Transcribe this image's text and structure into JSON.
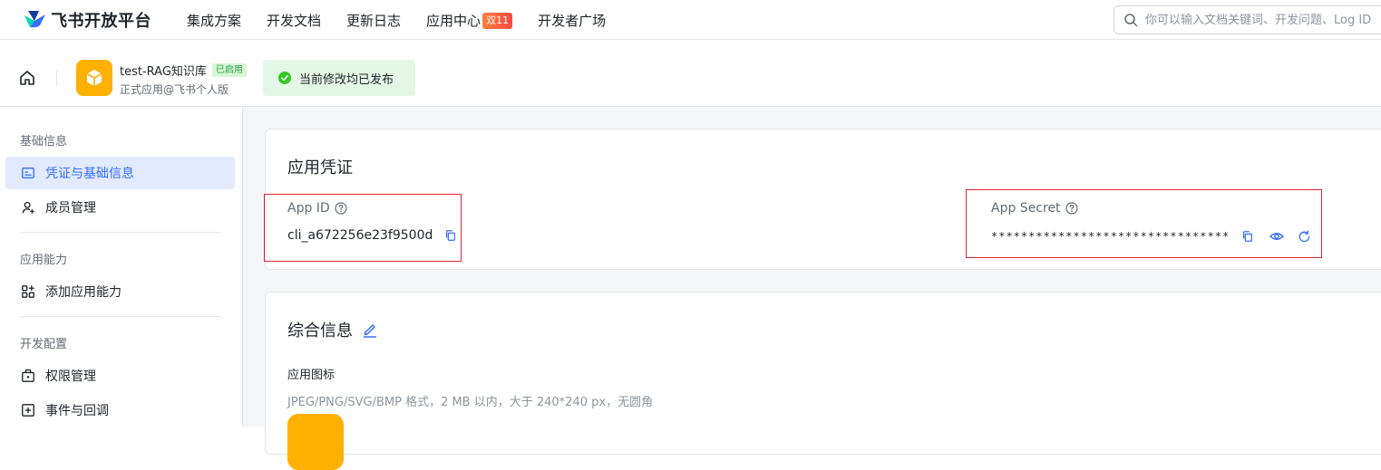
{
  "brand": {
    "name": "飞书开放平台"
  },
  "nav": {
    "items": [
      {
        "label": "集成方案"
      },
      {
        "label": "开发文档"
      },
      {
        "label": "更新日志"
      },
      {
        "label": "应用中心",
        "badge": "双11"
      },
      {
        "label": "开发者广场"
      }
    ]
  },
  "search": {
    "placeholder": "你可以输入文档关键词、开发问题、Log ID"
  },
  "app": {
    "name": "test-RAG知识库",
    "status": "已启用",
    "subtitle": "正式应用@飞书个人版",
    "publish_status": "当前修改均已发布"
  },
  "sidebar": {
    "groups": [
      {
        "title": "基础信息",
        "items": [
          {
            "label": "凭证与基础信息",
            "icon": "credential-icon"
          },
          {
            "label": "成员管理",
            "icon": "member-add-icon"
          }
        ]
      },
      {
        "title": "应用能力",
        "items": [
          {
            "label": "添加应用能力",
            "icon": "apps-add-icon"
          }
        ]
      },
      {
        "title": "开发配置",
        "items": [
          {
            "label": "权限管理",
            "icon": "lock-box-icon"
          },
          {
            "label": "事件与回调",
            "icon": "event-plus-icon"
          }
        ]
      }
    ]
  },
  "credentials": {
    "title": "应用凭证",
    "app_id_label": "App ID",
    "app_id_value": "cli_a672256e23f9500d",
    "app_secret_label": "App Secret",
    "app_secret_value": "********************************"
  },
  "general": {
    "title": "综合信息",
    "icon_label": "应用图标",
    "icon_hint": "JPEG/PNG/SVG/BMP 格式，2 MB 以内，大于 240*240 px，无圆角"
  },
  "colors": {
    "accent": "#3370ff",
    "app_icon": "#ffb000",
    "success": "#24a148",
    "highlight": "#e0262d"
  }
}
